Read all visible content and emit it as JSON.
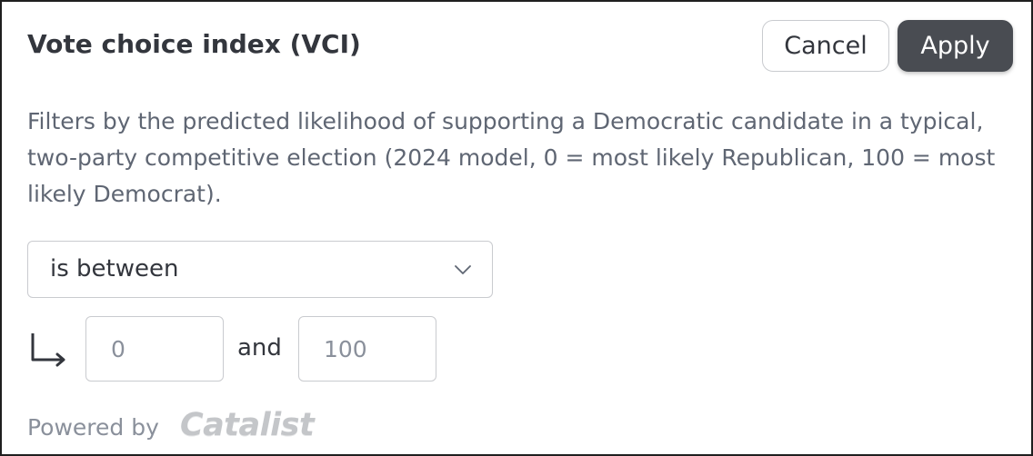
{
  "dialog": {
    "title": "Vote choice index (VCI)",
    "cancel_label": "Cancel",
    "apply_label": "Apply",
    "description": "Filters by the predicted likelihood of supporting a Democratic candidate in a typical, two-party competitive election (2024 model, 0 = most likely Republican, 100 = most likely Democrat)."
  },
  "filter": {
    "operator_value": "is between",
    "min_placeholder": "0",
    "max_placeholder": "100",
    "and_label": "and",
    "chevron_icon": "chevron-down-icon",
    "arrow_icon": "arrow-down-right-icon"
  },
  "footer": {
    "powered_by": "Powered by",
    "brand_name": "Catalist"
  },
  "colors": {
    "apply_bg": "#494c52",
    "text": "#33363d",
    "muted": "#5f6673",
    "border": "#c9cbcf"
  }
}
